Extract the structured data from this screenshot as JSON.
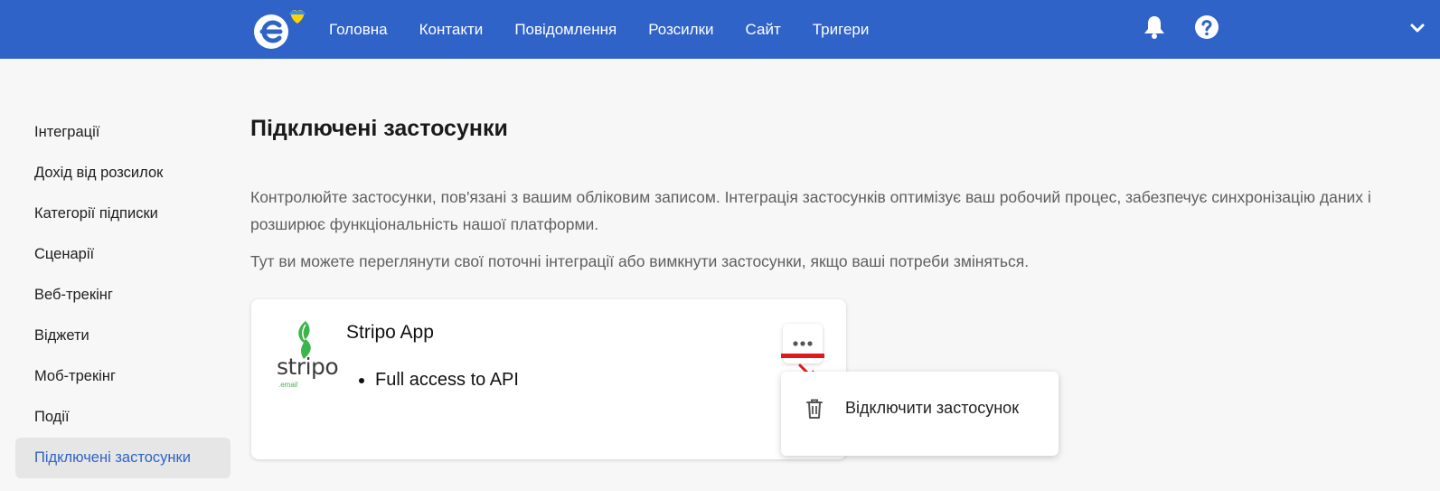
{
  "header": {
    "brand_icon": "esputnik-logo-heart",
    "nav": [
      {
        "label": "Головна"
      },
      {
        "label": "Контакти"
      },
      {
        "label": "Повідомлення"
      },
      {
        "label": "Розсилки"
      },
      {
        "label": "Сайт"
      },
      {
        "label": "Тригери"
      }
    ],
    "icons": [
      "bell-icon",
      "help-icon",
      "chevron-down-icon"
    ],
    "accent_color": "#2f63c8"
  },
  "sidebar": {
    "items": [
      {
        "label": "Інтеграції"
      },
      {
        "label": "Дохід від розсилок"
      },
      {
        "label": "Категорії підписки"
      },
      {
        "label": "Сценарії"
      },
      {
        "label": "Веб-трекінг"
      },
      {
        "label": "Віджети"
      },
      {
        "label": "Моб-трекінг"
      },
      {
        "label": "Події"
      },
      {
        "label": "Підключені застосунки",
        "active": true
      }
    ]
  },
  "main": {
    "title": "Підключені застосунки",
    "description": "Контролюйте застосунки, пов'язані з вашим обліковим записом. Інтеграція застосунків оптимізує ваш робочий процес, забезпечує синхронізацію даних і розширює функціональність нашої платформи.",
    "description2": "Тут ви можете переглянути свої поточні інтеграції або вимкнути застосунки, якщо ваші потреби зміняться.",
    "app": {
      "logo_text": "stripo",
      "logo_sub": ".email",
      "name": "Stripo App",
      "permissions": [
        "Full access to API"
      ]
    },
    "menu": {
      "items": [
        {
          "label": "Відключити застосунок",
          "icon": "trash-icon"
        }
      ]
    }
  }
}
